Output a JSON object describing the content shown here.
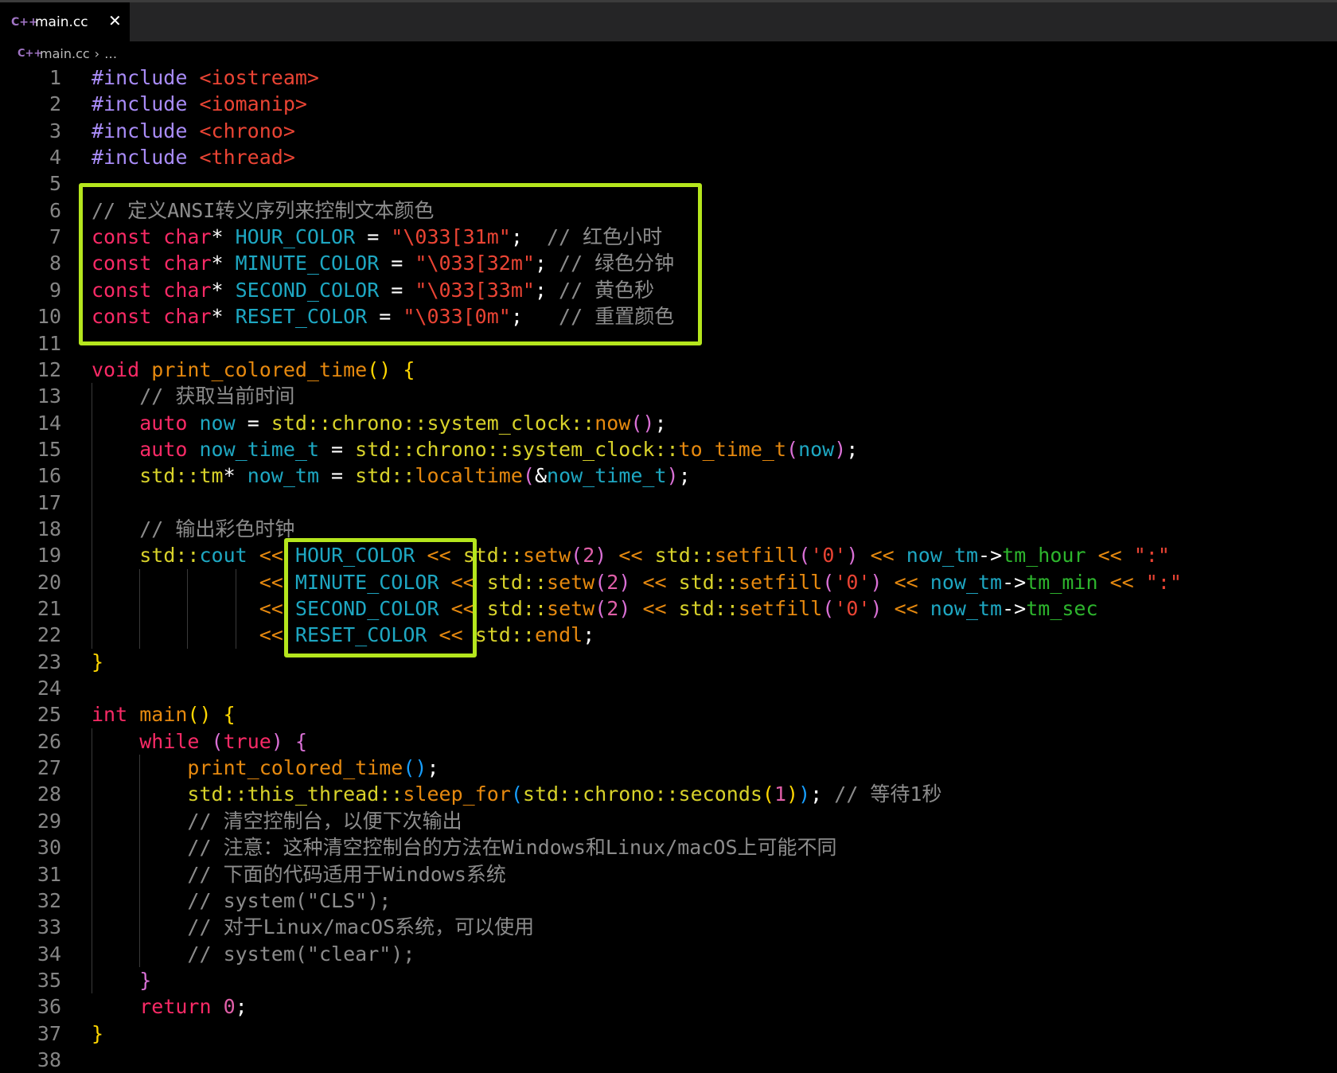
{
  "tab": {
    "icon": "cpp-file-icon",
    "icon_text": "C++",
    "label": "main.cc",
    "close": "✕"
  },
  "breadcrumb": {
    "file": "main.cc",
    "separator": "›",
    "more": "…"
  },
  "colors": {
    "highlight_box": "#b5e61d",
    "background": "#000000"
  },
  "lines": [
    [
      [
        "pp",
        "#include "
      ],
      [
        "str",
        "<iostream>"
      ]
    ],
    [
      [
        "pp",
        "#include "
      ],
      [
        "str",
        "<iomanip>"
      ]
    ],
    [
      [
        "pp",
        "#include "
      ],
      [
        "str",
        "<chrono>"
      ]
    ],
    [
      [
        "pp",
        "#include "
      ],
      [
        "str",
        "<thread>"
      ]
    ],
    [],
    [
      [
        "cm",
        "// 定义ANSI转义序列来控制文本颜色"
      ]
    ],
    [
      [
        "kw",
        "const char"
      ],
      [
        "op",
        "* "
      ],
      [
        "id",
        "HOUR_COLOR"
      ],
      [
        "op",
        " = "
      ],
      [
        "str",
        "\"\\033[31m\""
      ],
      [
        "op",
        ";  "
      ],
      [
        "cm",
        "// 红色小时"
      ]
    ],
    [
      [
        "kw",
        "const char"
      ],
      [
        "op",
        "* "
      ],
      [
        "id",
        "MINUTE_COLOR"
      ],
      [
        "op",
        " = "
      ],
      [
        "str",
        "\"\\033[32m\""
      ],
      [
        "op",
        "; "
      ],
      [
        "cm",
        "// 绿色分钟"
      ]
    ],
    [
      [
        "kw",
        "const char"
      ],
      [
        "op",
        "* "
      ],
      [
        "id",
        "SECOND_COLOR"
      ],
      [
        "op",
        " = "
      ],
      [
        "str",
        "\"\\033[33m\""
      ],
      [
        "op",
        "; "
      ],
      [
        "cm",
        "// 黄色秒"
      ]
    ],
    [
      [
        "kw",
        "const char"
      ],
      [
        "op",
        "* "
      ],
      [
        "id",
        "RESET_COLOR"
      ],
      [
        "op",
        " = "
      ],
      [
        "str",
        "\"\\033[0m\""
      ],
      [
        "op",
        ";   "
      ],
      [
        "cm",
        "// 重置颜色"
      ]
    ],
    [],
    [
      [
        "kw",
        "void "
      ],
      [
        "fn",
        "print_colored_time"
      ],
      [
        "b1",
        "()"
      ],
      [
        "op",
        " "
      ],
      [
        "b1",
        "{"
      ]
    ],
    [
      [
        "op",
        "    "
      ],
      [
        "cm",
        "// 获取当前时间"
      ]
    ],
    [
      [
        "op",
        "    "
      ],
      [
        "kw",
        "auto "
      ],
      [
        "id",
        "now"
      ],
      [
        "op",
        " = "
      ],
      [
        "ns",
        "std::chrono::system_clock::"
      ],
      [
        "fn",
        "now"
      ],
      [
        "b2",
        "()"
      ],
      [
        "op",
        ";"
      ]
    ],
    [
      [
        "op",
        "    "
      ],
      [
        "kw",
        "auto "
      ],
      [
        "id",
        "now_time_t"
      ],
      [
        "op",
        " = "
      ],
      [
        "ns",
        "std::chrono::system_clock::"
      ],
      [
        "fn",
        "to_time_t"
      ],
      [
        "b2",
        "("
      ],
      [
        "id",
        "now"
      ],
      [
        "b2",
        ")"
      ],
      [
        "op",
        ";"
      ]
    ],
    [
      [
        "op",
        "    "
      ],
      [
        "ns",
        "std::tm"
      ],
      [
        "op",
        "* "
      ],
      [
        "id",
        "now_tm"
      ],
      [
        "op",
        " = "
      ],
      [
        "ns",
        "std::"
      ],
      [
        "fn",
        "localtime"
      ],
      [
        "b2",
        "("
      ],
      [
        "op",
        "&"
      ],
      [
        "id",
        "now_time_t"
      ],
      [
        "b2",
        ")"
      ],
      [
        "op",
        ";"
      ]
    ],
    [],
    [
      [
        "op",
        "    "
      ],
      [
        "cm",
        "// 输出彩色时钟"
      ]
    ],
    [
      [
        "op",
        "    "
      ],
      [
        "ns",
        "std::"
      ],
      [
        "id",
        "cout"
      ],
      [
        "op",
        " "
      ],
      [
        "sh",
        "<<"
      ],
      [
        "op",
        " "
      ],
      [
        "id",
        "HOUR_COLOR"
      ],
      [
        "op",
        " "
      ],
      [
        "sh",
        "<<"
      ],
      [
        "op",
        " "
      ],
      [
        "ns",
        "std::"
      ],
      [
        "fn",
        "setw"
      ],
      [
        "b2",
        "("
      ],
      [
        "num",
        "2"
      ],
      [
        "b2",
        ")"
      ],
      [
        "op",
        " "
      ],
      [
        "sh",
        "<<"
      ],
      [
        "op",
        " "
      ],
      [
        "ns",
        "std::"
      ],
      [
        "fn",
        "setfill"
      ],
      [
        "b2",
        "("
      ],
      [
        "str",
        "'0'"
      ],
      [
        "b2",
        ")"
      ],
      [
        "op",
        " "
      ],
      [
        "sh",
        "<<"
      ],
      [
        "op",
        " "
      ],
      [
        "id",
        "now_tm"
      ],
      [
        "op",
        "->"
      ],
      [
        "mem",
        "tm_hour"
      ],
      [
        "op",
        " "
      ],
      [
        "sh",
        "<<"
      ],
      [
        "op",
        " "
      ],
      [
        "str",
        "\":\""
      ]
    ],
    [
      [
        "op",
        "              "
      ],
      [
        "sh",
        "<<"
      ],
      [
        "op",
        " "
      ],
      [
        "id",
        "MINUTE_COLOR"
      ],
      [
        "op",
        " "
      ],
      [
        "sh",
        "<<"
      ],
      [
        "op",
        " "
      ],
      [
        "ns",
        "std::"
      ],
      [
        "fn",
        "setw"
      ],
      [
        "b2",
        "("
      ],
      [
        "num",
        "2"
      ],
      [
        "b2",
        ")"
      ],
      [
        "op",
        " "
      ],
      [
        "sh",
        "<<"
      ],
      [
        "op",
        " "
      ],
      [
        "ns",
        "std::"
      ],
      [
        "fn",
        "setfill"
      ],
      [
        "b2",
        "("
      ],
      [
        "str",
        "'0'"
      ],
      [
        "b2",
        ")"
      ],
      [
        "op",
        " "
      ],
      [
        "sh",
        "<<"
      ],
      [
        "op",
        " "
      ],
      [
        "id",
        "now_tm"
      ],
      [
        "op",
        "->"
      ],
      [
        "mem",
        "tm_min"
      ],
      [
        "op",
        " "
      ],
      [
        "sh",
        "<<"
      ],
      [
        "op",
        " "
      ],
      [
        "str",
        "\":\""
      ]
    ],
    [
      [
        "op",
        "              "
      ],
      [
        "sh",
        "<<"
      ],
      [
        "op",
        " "
      ],
      [
        "id",
        "SECOND_COLOR"
      ],
      [
        "op",
        " "
      ],
      [
        "sh",
        "<<"
      ],
      [
        "op",
        " "
      ],
      [
        "ns",
        "std::"
      ],
      [
        "fn",
        "setw"
      ],
      [
        "b2",
        "("
      ],
      [
        "num",
        "2"
      ],
      [
        "b2",
        ")"
      ],
      [
        "op",
        " "
      ],
      [
        "sh",
        "<<"
      ],
      [
        "op",
        " "
      ],
      [
        "ns",
        "std::"
      ],
      [
        "fn",
        "setfill"
      ],
      [
        "b2",
        "("
      ],
      [
        "str",
        "'0'"
      ],
      [
        "b2",
        ")"
      ],
      [
        "op",
        " "
      ],
      [
        "sh",
        "<<"
      ],
      [
        "op",
        " "
      ],
      [
        "id",
        "now_tm"
      ],
      [
        "op",
        "->"
      ],
      [
        "mem",
        "tm_sec"
      ]
    ],
    [
      [
        "op",
        "              "
      ],
      [
        "sh",
        "<<"
      ],
      [
        "op",
        " "
      ],
      [
        "id",
        "RESET_COLOR"
      ],
      [
        "op",
        " "
      ],
      [
        "sh",
        "<<"
      ],
      [
        "op",
        " "
      ],
      [
        "ns",
        "std::"
      ],
      [
        "fn",
        "endl"
      ],
      [
        "op",
        ";"
      ]
    ],
    [
      [
        "b1",
        "}"
      ]
    ],
    [],
    [
      [
        "kw",
        "int "
      ],
      [
        "fn",
        "main"
      ],
      [
        "b1",
        "()"
      ],
      [
        "op",
        " "
      ],
      [
        "b1",
        "{"
      ]
    ],
    [
      [
        "op",
        "    "
      ],
      [
        "kw",
        "while "
      ],
      [
        "b2",
        "("
      ],
      [
        "kw",
        "true"
      ],
      [
        "b2",
        ")"
      ],
      [
        "op",
        " "
      ],
      [
        "b2",
        "{"
      ]
    ],
    [
      [
        "op",
        "        "
      ],
      [
        "fn",
        "print_colored_time"
      ],
      [
        "b3",
        "()"
      ],
      [
        "op",
        ";"
      ]
    ],
    [
      [
        "op",
        "        "
      ],
      [
        "ns",
        "std::this_thread::"
      ],
      [
        "fn",
        "sleep_for"
      ],
      [
        "b3",
        "("
      ],
      [
        "ns",
        "std::chrono::seconds"
      ],
      [
        "b1",
        "("
      ],
      [
        "num",
        "1"
      ],
      [
        "b1",
        ")"
      ],
      [
        "b3",
        ")"
      ],
      [
        "op",
        "; "
      ],
      [
        "cm",
        "// 等待1秒"
      ]
    ],
    [
      [
        "op",
        "        "
      ],
      [
        "cm",
        "// 清空控制台，以便下次输出"
      ]
    ],
    [
      [
        "op",
        "        "
      ],
      [
        "cm",
        "// 注意：这种清空控制台的方法在Windows和Linux/macOS上可能不同"
      ]
    ],
    [
      [
        "op",
        "        "
      ],
      [
        "cm",
        "// 下面的代码适用于Windows系统"
      ]
    ],
    [
      [
        "op",
        "        "
      ],
      [
        "cm",
        "// system(\"CLS\");"
      ]
    ],
    [
      [
        "op",
        "        "
      ],
      [
        "cm",
        "// 对于Linux/macOS系统，可以使用"
      ]
    ],
    [
      [
        "op",
        "        "
      ],
      [
        "cm",
        "// system(\"clear\");"
      ]
    ],
    [
      [
        "op",
        "    "
      ],
      [
        "b2",
        "}"
      ]
    ],
    [
      [
        "op",
        "    "
      ],
      [
        "kw",
        "return "
      ],
      [
        "num",
        "0"
      ],
      [
        "op",
        ";"
      ]
    ],
    [
      [
        "b1",
        "}"
      ]
    ],
    []
  ]
}
